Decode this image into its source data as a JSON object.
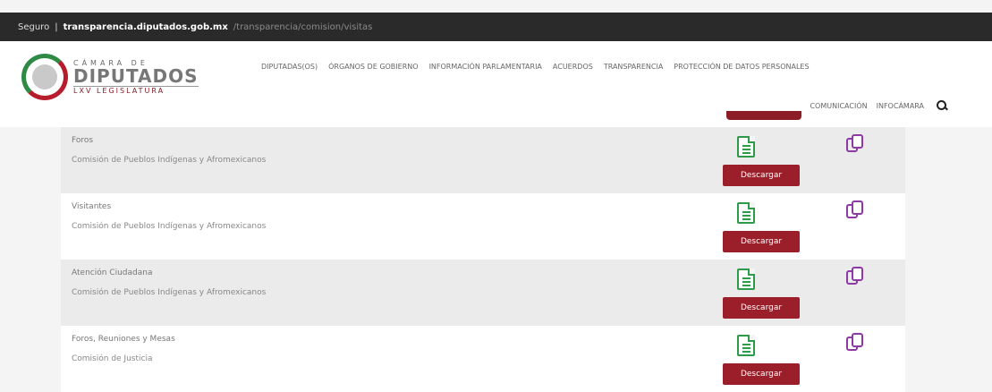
{
  "browser": {
    "prefix": "Seguro",
    "domain": "transparencia.diputados.gob.mx",
    "path": "/transparencia/comision/visitas"
  },
  "logo": {
    "camara": "CÁMARA DE",
    "diputados": "DIPUTADOS",
    "legislatura": "LXV LEGISLATURA"
  },
  "nav": {
    "row1": [
      "DIPUTADAS(OS)",
      "ÓRGANOS DE GOBIERNO",
      "INFORMACIÓN PARLAMENTARIA",
      "ACUERDOS",
      "TRANSPARENCIA",
      "PROTECCIÓN DE DATOS PERSONALES"
    ],
    "row2": [
      "COMUNICACIÓN",
      "INFOCÁMARA"
    ]
  },
  "rows": [
    {
      "title": "Foros",
      "subtitle": "Comisión de Pueblos Indígenas y Afromexicanos",
      "button": "Descargar"
    },
    {
      "title": "Visitantes",
      "subtitle": "Comisión de Pueblos Indígenas y Afromexicanos",
      "button": "Descargar"
    },
    {
      "title": "Atención Ciudadana",
      "subtitle": "Comisión de Pueblos Indígenas y Afromexicanos",
      "button": "Descargar"
    },
    {
      "title": "Foros, Reuniones y Mesas",
      "subtitle": "Comisión de Justicia",
      "button": "Descargar"
    }
  ],
  "colors": {
    "accent": "#9b1f2a",
    "doc_icon": "#2e9b4a",
    "copy_icon": "#8e3aa6"
  },
  "icons": {
    "document": "document-icon",
    "copy": "copy-icon",
    "search": "search-icon"
  }
}
